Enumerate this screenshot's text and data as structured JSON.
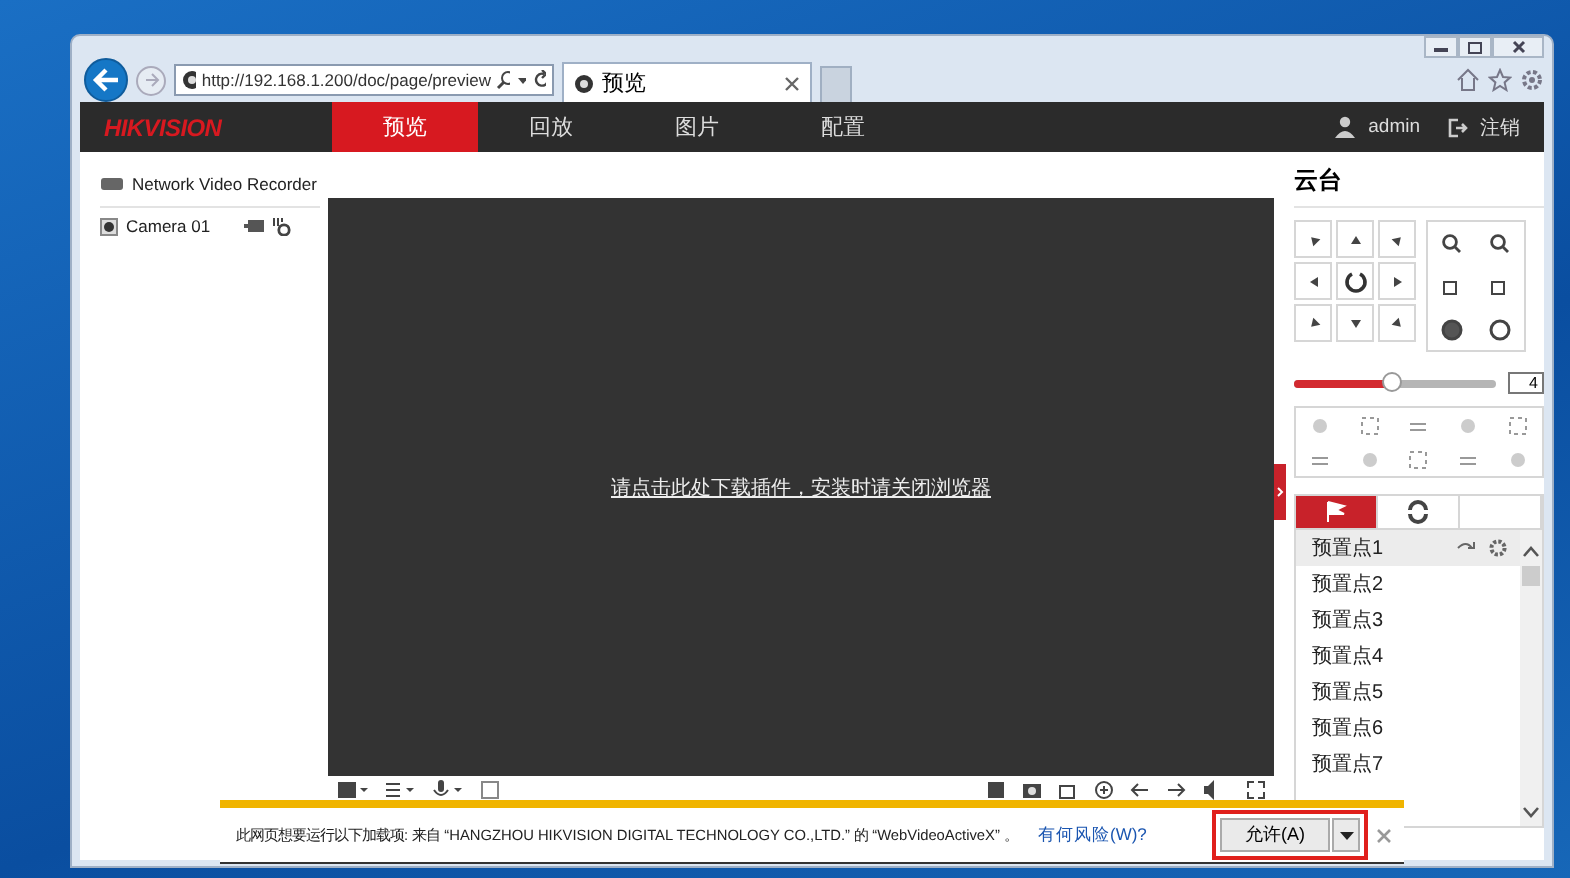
{
  "browser": {
    "address": "http://192.168.1.200/doc/page/preview",
    "tab": {
      "title": "预览"
    }
  },
  "header": {
    "logo": "HIKVISION",
    "nav": [
      {
        "label": "预览",
        "selected": true
      },
      {
        "label": "回放",
        "selected": false
      },
      {
        "label": "图片",
        "selected": false
      },
      {
        "label": "配置",
        "selected": false
      }
    ],
    "user": "admin",
    "logout": "注销"
  },
  "sidebar": {
    "device": "Network Video Recorder",
    "cameras": [
      {
        "name": "Camera 01"
      }
    ]
  },
  "video": {
    "plugin_link": "请点击此处下载插件，安装时请关闭浏览器"
  },
  "ptz": {
    "title": "云台",
    "speed": {
      "level": 0.49,
      "value": "4"
    },
    "tabs": [
      {
        "kind": "preset",
        "selected": true
      },
      {
        "kind": "patrol",
        "selected": false
      },
      {
        "kind": "pattern",
        "selected": false
      }
    ],
    "presets": [
      {
        "label": "预置点1",
        "selected": true
      },
      {
        "label": "预置点2",
        "selected": false
      },
      {
        "label": "预置点3",
        "selected": false
      },
      {
        "label": "预置点4",
        "selected": false
      },
      {
        "label": "预置点5",
        "selected": false
      },
      {
        "label": "预置点6",
        "selected": false
      },
      {
        "label": "预置点7",
        "selected": false
      }
    ]
  },
  "notification": {
    "message": "此网页想要运行以下加载项: 来自 “HANGZHOU HIKVISION DIGITAL TECHNOLOGY CO.,LTD.” 的 “WebVideoActiveX” 。",
    "link": "有何风险(W)?",
    "allow_button": "允许(A)"
  }
}
